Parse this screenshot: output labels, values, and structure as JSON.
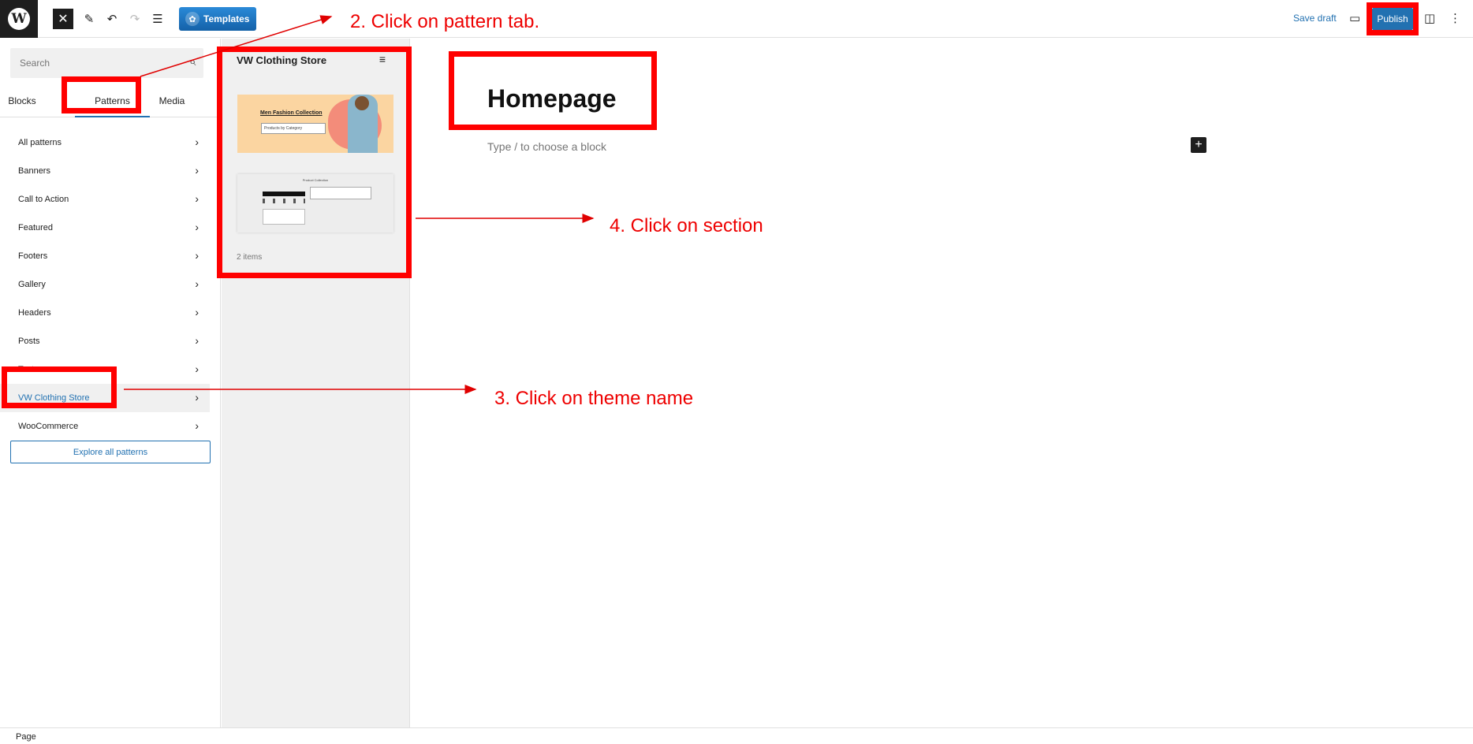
{
  "toolbar": {
    "wp_logo": "W",
    "close_glyph": "✕",
    "edit_glyph": "✎",
    "undo_glyph": "↶",
    "redo_glyph": "↷",
    "list_view_glyph": "☰",
    "templates_label": "Templates",
    "templates_icon": "✿",
    "save_draft_label": "Save draft",
    "preview_glyph": "▭",
    "publish_label": "Publish",
    "settings_glyph": "◫",
    "options_glyph": "⋮"
  },
  "sidebar": {
    "search_placeholder": "Search",
    "search_glyph": "⌕",
    "tabs": [
      {
        "label": "Blocks"
      },
      {
        "label": "Patterns",
        "active": true
      },
      {
        "label": "Media"
      }
    ],
    "categories": [
      {
        "label": "All patterns"
      },
      {
        "label": "Banners"
      },
      {
        "label": "Call to Action"
      },
      {
        "label": "Featured"
      },
      {
        "label": "Footers"
      },
      {
        "label": "Gallery"
      },
      {
        "label": "Headers"
      },
      {
        "label": "Posts"
      },
      {
        "label": "Text"
      },
      {
        "label": "VW Clothing Store",
        "active": true
      },
      {
        "label": "WooCommerce"
      }
    ],
    "chevron_glyph": "›",
    "explore_label": "Explore all patterns"
  },
  "preview_panel": {
    "title": "VW Clothing Store",
    "filter_glyph": "≡",
    "card1_title": "Men Fashion Collection",
    "card1_box": "Products by Category",
    "card2_title": "Product Collection",
    "count": "2 items"
  },
  "canvas": {
    "title": "Homepage",
    "placeholder": "Type / to choose a block",
    "add_glyph": "+"
  },
  "footer": {
    "breadcrumb": "Page"
  },
  "annotations": {
    "step2": "2. Click on pattern tab.",
    "step3": "3. Click on theme name",
    "step4": "4. Click on section",
    "color": "#e00000"
  }
}
